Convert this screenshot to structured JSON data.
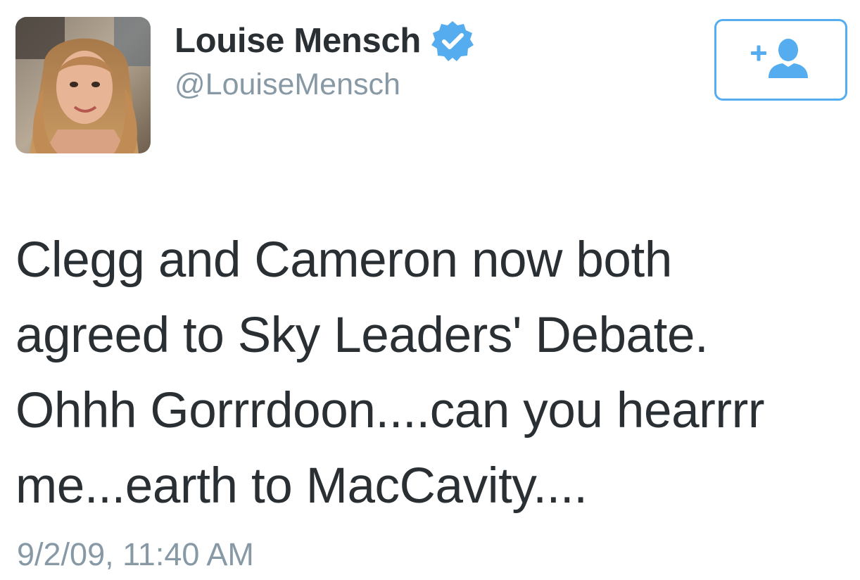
{
  "user": {
    "display_name": "Louise Mensch",
    "handle": "@LouiseMensch",
    "verified": true,
    "avatar": "profile-photo"
  },
  "actions": {
    "follow_icon": "add-user-icon"
  },
  "tweet": {
    "text_lines": [
      "Clegg and Cameron now both",
      "agreed to Sky Leaders' Debate.",
      "Ohhh Gorrrdoon....can you hearrrr",
      "me...earth to MacCavity...."
    ],
    "timestamp": "9/2/09, 11:40 AM"
  },
  "colors": {
    "accent": "#55acee",
    "text": "#292f33",
    "muted": "#8899a6",
    "background": "#ffffff"
  }
}
